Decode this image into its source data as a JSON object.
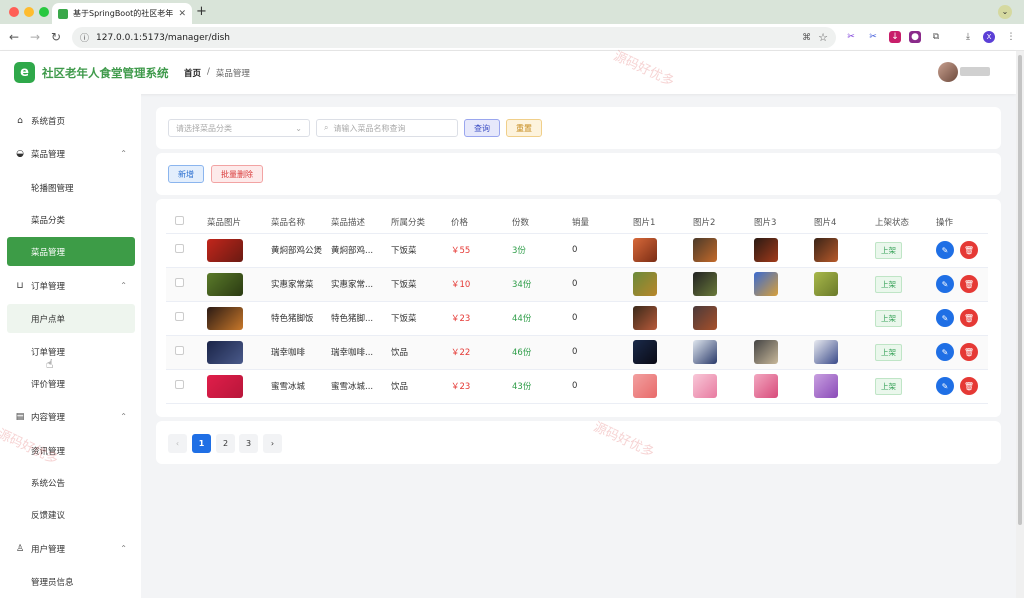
{
  "browser": {
    "tab_title": "基于SpringBoot的社区老年人食",
    "url": "127.0.0.1:5173/manager/dish",
    "profile_letter": "X"
  },
  "header": {
    "app_title": "社区老年人食堂管理系统",
    "logo_letter": "e",
    "breadcrumb_home": "首页",
    "breadcrumb_sep": "/",
    "breadcrumb_current": "菜品管理"
  },
  "sidebar": {
    "items": [
      {
        "label": "系统首页",
        "icon": "home-icon"
      },
      {
        "label": "菜品管理",
        "icon": "bowl-icon",
        "group": true
      },
      {
        "label": "轮播图管理",
        "sub": true
      },
      {
        "label": "菜品分类",
        "sub": true
      },
      {
        "label": "菜品管理",
        "sub": true,
        "active": true
      },
      {
        "label": "订单管理",
        "icon": "cart-icon",
        "group": true
      },
      {
        "label": "用户点单",
        "sub": true
      },
      {
        "label": "订单管理",
        "sub": true
      },
      {
        "label": "评价管理",
        "sub": true
      },
      {
        "label": "内容管理",
        "icon": "document-icon",
        "group": true
      },
      {
        "label": "资讯管理",
        "sub": true
      },
      {
        "label": "系统公告",
        "sub": true
      },
      {
        "label": "反馈建议",
        "sub": true
      },
      {
        "label": "用户管理",
        "icon": "user-icon",
        "group": true
      },
      {
        "label": "管理员信息",
        "sub": true
      }
    ]
  },
  "search": {
    "category_placeholder": "请选择菜品分类",
    "name_placeholder": "请输入菜品名称查询",
    "query_label": "查询",
    "reset_label": "重置"
  },
  "actions": {
    "add_label": "新增",
    "batch_delete_label": "批量删除"
  },
  "table": {
    "columns": [
      "菜品图片",
      "菜品名称",
      "菜品描述",
      "所属分类",
      "价格",
      "份数",
      "销量",
      "图片1",
      "图片2",
      "图片3",
      "图片4",
      "上架状态",
      "操作"
    ],
    "rows": [
      {
        "name": "黄焖部鸡公煲",
        "desc": "黄焖部鸡...",
        "category": "下饭菜",
        "price": "￥55",
        "qty": "3份",
        "sales": "0",
        "status": "上架"
      },
      {
        "name": "实惠家常菜",
        "desc": "实惠家常...",
        "category": "下饭菜",
        "price": "￥10",
        "qty": "34份",
        "sales": "0",
        "status": "上架"
      },
      {
        "name": "特色猪脚饭",
        "desc": "特色猪脚...",
        "category": "下饭菜",
        "price": "￥23",
        "qty": "44份",
        "sales": "0",
        "status": "上架"
      },
      {
        "name": "瑞幸咖啡",
        "desc": "瑞幸咖啡...",
        "category": "饮品",
        "price": "￥22",
        "qty": "46份",
        "sales": "0",
        "status": "上架"
      },
      {
        "name": "蜜雪冰城",
        "desc": "蜜雪冰城...",
        "category": "饮品",
        "price": "￥23",
        "qty": "43份",
        "sales": "0",
        "status": "上架"
      }
    ]
  },
  "pagination": {
    "pages": [
      "1",
      "2",
      "3"
    ],
    "prev": "‹",
    "next": "›",
    "current": "1"
  },
  "watermark": "源码好优多",
  "colors": {
    "brand": "#3d9c47",
    "primary": "#1f6fe5",
    "danger": "#e53935"
  }
}
